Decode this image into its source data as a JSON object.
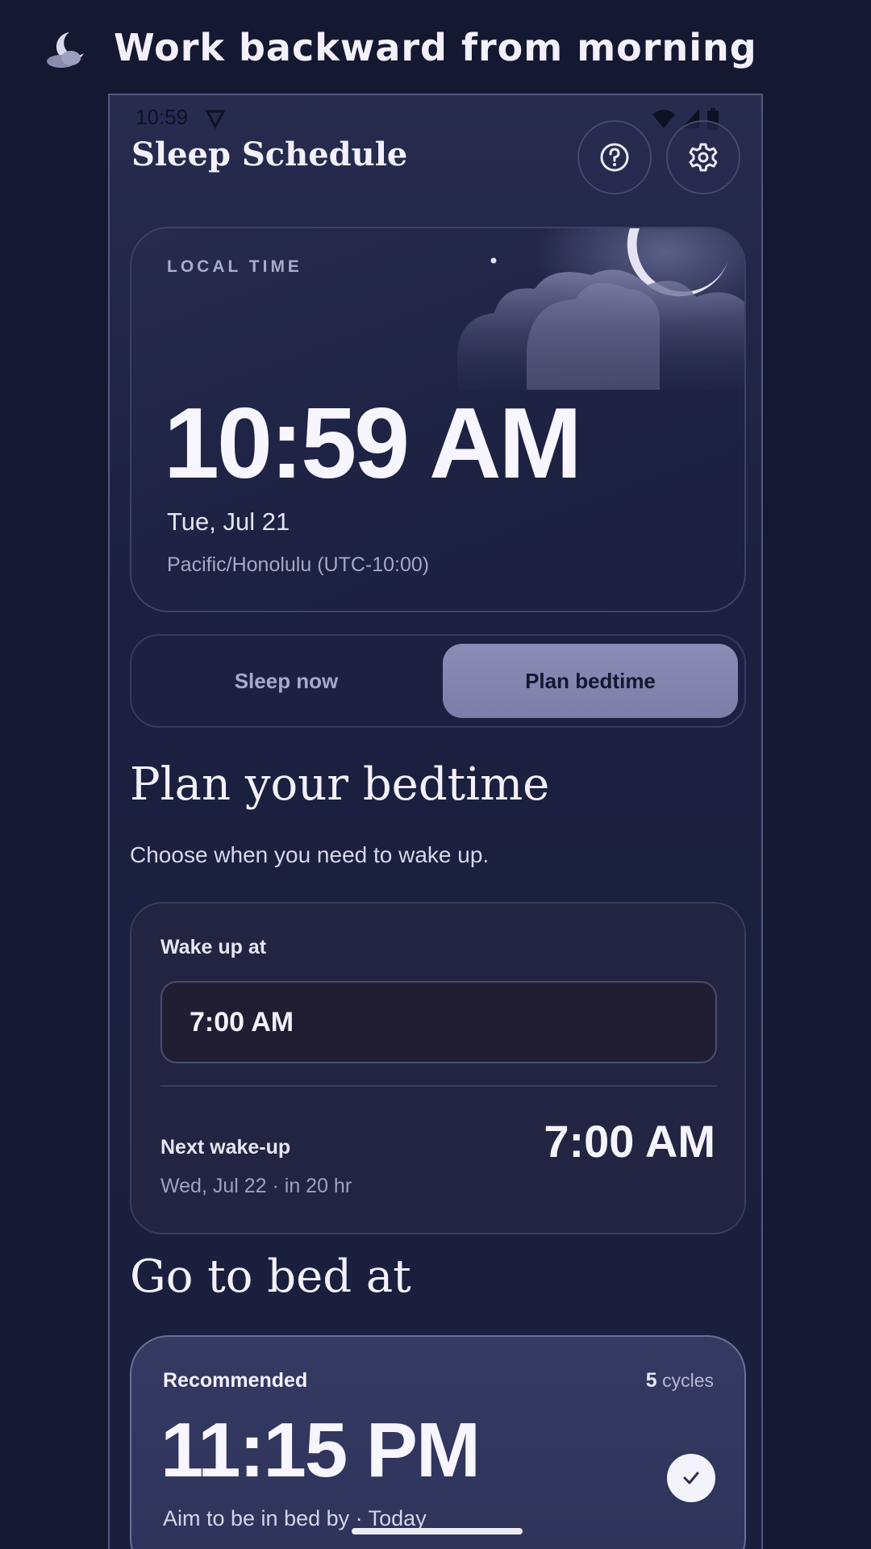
{
  "banner": {
    "title": "Work backward from morning",
    "icon": "moon-cloud-icon"
  },
  "status_bar": {
    "time": "10:59"
  },
  "header": {
    "app_title": "Sleep Schedule",
    "help_icon": "help-circle-icon",
    "settings_icon": "gear-icon"
  },
  "time_card": {
    "label": "LOCAL TIME",
    "time": "10:59 AM",
    "date": "Tue, Jul 21",
    "timezone": "Pacific/Honolulu (UTC-10:00)"
  },
  "mode_toggle": {
    "options": [
      "Sleep now",
      "Plan bedtime"
    ],
    "selected": "Plan bedtime"
  },
  "plan": {
    "heading": "Plan your bedtime",
    "subtitle": "Choose when you need to wake up."
  },
  "wake_card": {
    "label": "Wake up at",
    "input_value": "7:00 AM",
    "next_label": "Next wake-up",
    "next_detail": "Wed, Jul 22 · in 20 hr",
    "next_time": "7:00 AM"
  },
  "bed": {
    "heading": "Go to bed at",
    "recommended_label": "Recommended",
    "cycles_count": "5",
    "cycles_unit": "cycles",
    "time": "11:15 PM",
    "subtitle": "Aim to be in bed by · Today"
  },
  "colors": {
    "background": "#141830",
    "accent": "#8a8db6",
    "text": "#f3f0fb"
  }
}
